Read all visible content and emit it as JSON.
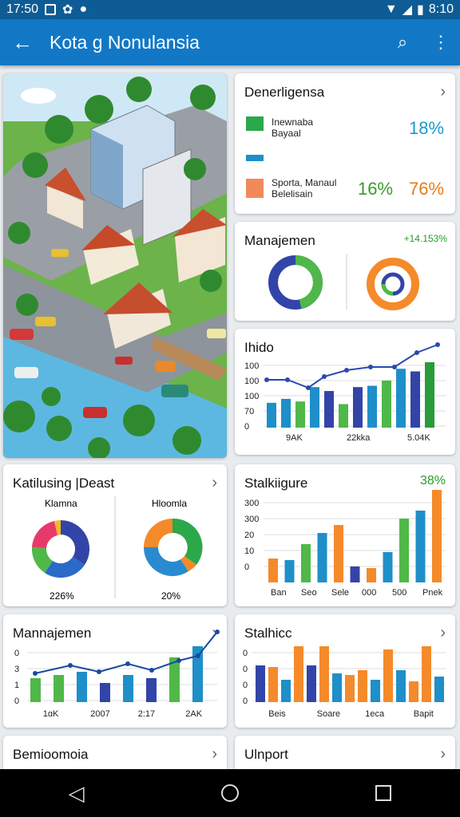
{
  "status": {
    "time": "17:50",
    "clock": "8:10"
  },
  "app": {
    "title": "Kota g Nonulansia"
  },
  "cards": {
    "c1": {
      "title": "Denerligensa",
      "l1a": "Inewnaba",
      "l1b": "Bayaal",
      "p1": "18%",
      "l2a": "Sporta, Manaul",
      "l2b": "Belelisain",
      "p2": "16%",
      "p3": "76%"
    },
    "c2": {
      "title": "Manajemen",
      "delta": "+14.153%"
    },
    "c3": {
      "title": "Ihido",
      "y": [
        "100",
        "100",
        "100",
        "70",
        "0"
      ],
      "x": [
        "9AK",
        "22kka",
        "5.04K"
      ]
    },
    "c4": {
      "title": "Katilusing |Deast",
      "l1": "Klamna",
      "l2": "Hloomla",
      "p1": "226%",
      "p2": "20%"
    },
    "c5": {
      "title": "Stalkiigure",
      "pct": "38%",
      "y": [
        "300",
        "300",
        "20",
        "10",
        "0"
      ],
      "x": [
        "Ban",
        "Seo",
        "Sele",
        "000",
        "500",
        "Pnek"
      ]
    },
    "c6": {
      "title": "Mannajemen",
      "y": [
        "0",
        "3",
        "1",
        "0"
      ],
      "x": [
        "1ɑK",
        "2007",
        "2:17",
        "2AK"
      ]
    },
    "c7": {
      "title": "Stalhicc",
      "y": [
        "0",
        "0",
        "0",
        "0"
      ],
      "x": [
        "Beis",
        "Soare",
        "1eca",
        "Bapit"
      ]
    },
    "c8": {
      "title": "Bemioomoia"
    },
    "c9": {
      "title": "Ulnport"
    }
  },
  "colors": {
    "blue": "#1e8fc8",
    "navy": "#3344a8",
    "green": "#4fb848",
    "orange": "#f58a2a",
    "dkgreen": "#2a9a3a"
  },
  "icons": [
    "back-arrow-icon",
    "search-icon",
    "more-vert-icon",
    "chevron-right-icon",
    "back-nav-icon",
    "home-nav-icon",
    "recents-nav-icon"
  ]
}
